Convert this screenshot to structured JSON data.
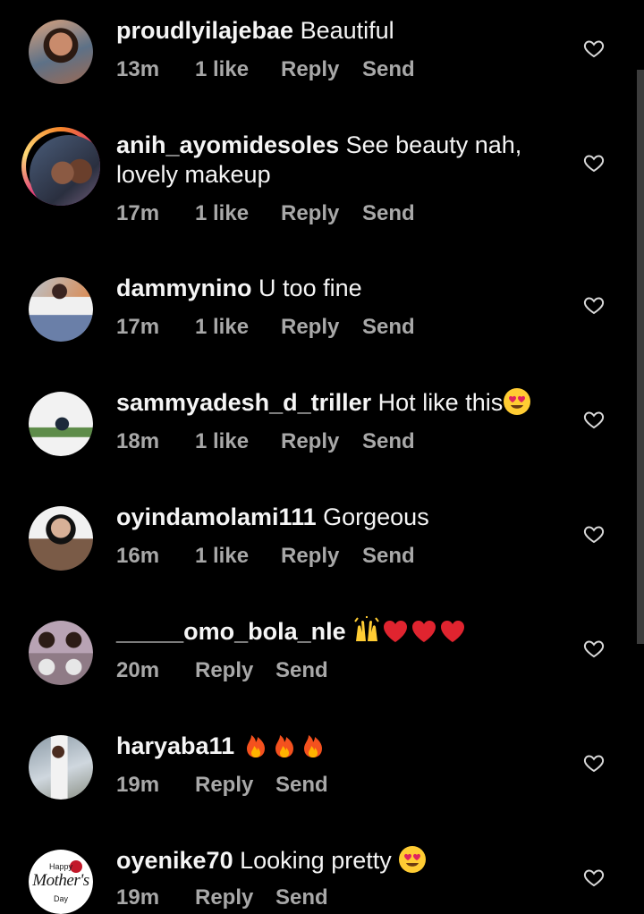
{
  "colors": {
    "background": "#000000",
    "text": "#f5f5f5",
    "meta": "#a8a8a8",
    "story_ring": "#dd2a7b",
    "scrollbar": "#3c3c3c"
  },
  "comments": [
    {
      "username": "proudlyilajebae",
      "text": "Beautiful",
      "time": "13m",
      "likes": "1 like",
      "reply": "Reply",
      "send": "Send",
      "icon": "heart-outline-icon"
    },
    {
      "username": "anih_ayomidesoles",
      "text": "See beauty nah, lovely makeup",
      "time": "17m",
      "likes": "1 like",
      "reply": "Reply",
      "send": "Send",
      "has_story_ring": true,
      "icon": "heart-outline-icon"
    },
    {
      "username": "dammynino",
      "text": "U too fine",
      "time": "17m",
      "likes": "1 like",
      "reply": "Reply",
      "send": "Send",
      "icon": "heart-outline-icon"
    },
    {
      "username": "sammyadesh_d_triller",
      "text": "Hot like this",
      "emoji": [
        "heart-eyes-emoji"
      ],
      "time": "18m",
      "likes": "1 like",
      "reply": "Reply",
      "send": "Send",
      "icon": "heart-outline-icon"
    },
    {
      "username": "oyindamolami111",
      "text": "Gorgeous",
      "time": "16m",
      "likes": "1 like",
      "reply": "Reply",
      "send": "Send",
      "icon": "heart-outline-icon"
    },
    {
      "username": "_____omo_bola_nle",
      "text": "",
      "emoji": [
        "raising-hands-emoji",
        "red-heart-emoji",
        "red-heart-emoji",
        "red-heart-emoji"
      ],
      "time": "20m",
      "reply": "Reply",
      "send": "Send",
      "icon": "heart-outline-icon"
    },
    {
      "username": "haryaba11",
      "text": "",
      "emoji": [
        "fire-emoji",
        "fire-emoji",
        "fire-emoji"
      ],
      "time": "19m",
      "reply": "Reply",
      "send": "Send",
      "icon": "heart-outline-icon"
    },
    {
      "username": "oyenike70",
      "text": "Looking pretty",
      "emoji": [
        "heart-eyes-emoji"
      ],
      "time": "19m",
      "reply": "Reply",
      "send": "Send",
      "avatar_text": {
        "happy": "Happy",
        "main": "Mother's",
        "day": "Day"
      },
      "icon": "heart-outline-icon"
    }
  ]
}
